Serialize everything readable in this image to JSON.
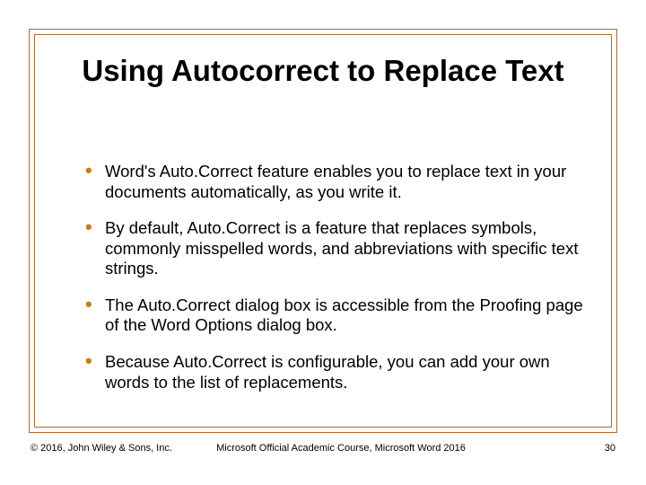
{
  "slide": {
    "title": "Using Autocorrect to Replace Text",
    "bullets": [
      "Word's Auto.Correct feature enables you to replace text in your documents automatically, as you write it.",
      "By default, Auto.Correct is a feature that replaces symbols, commonly misspelled words, and abbreviations with specific text strings.",
      "The Auto.Correct dialog box is accessible from the Proofing page of the Word Options dialog box.",
      "Because Auto.Correct is configurable, you can add your own words to the list of replacements."
    ]
  },
  "footer": {
    "copyright": "© 2016, John Wiley & Sons, Inc.",
    "course": "Microsoft Official Academic Course, Microsoft Word 2016",
    "page": "30"
  }
}
